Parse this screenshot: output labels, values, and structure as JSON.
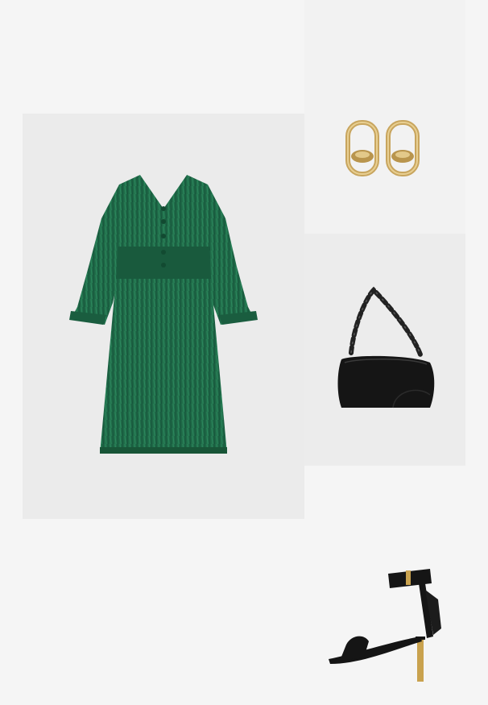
{
  "outfit": {
    "items": [
      {
        "id": "dress",
        "icon": "dress-icon",
        "color": "#1e6a47"
      },
      {
        "id": "earrings",
        "icon": "earrings-icon",
        "color": "#c8a55e"
      },
      {
        "id": "bag",
        "icon": "handbag-icon",
        "color": "#151515"
      },
      {
        "id": "sandal",
        "icon": "sandal-icon",
        "color": "#151515"
      }
    ]
  }
}
